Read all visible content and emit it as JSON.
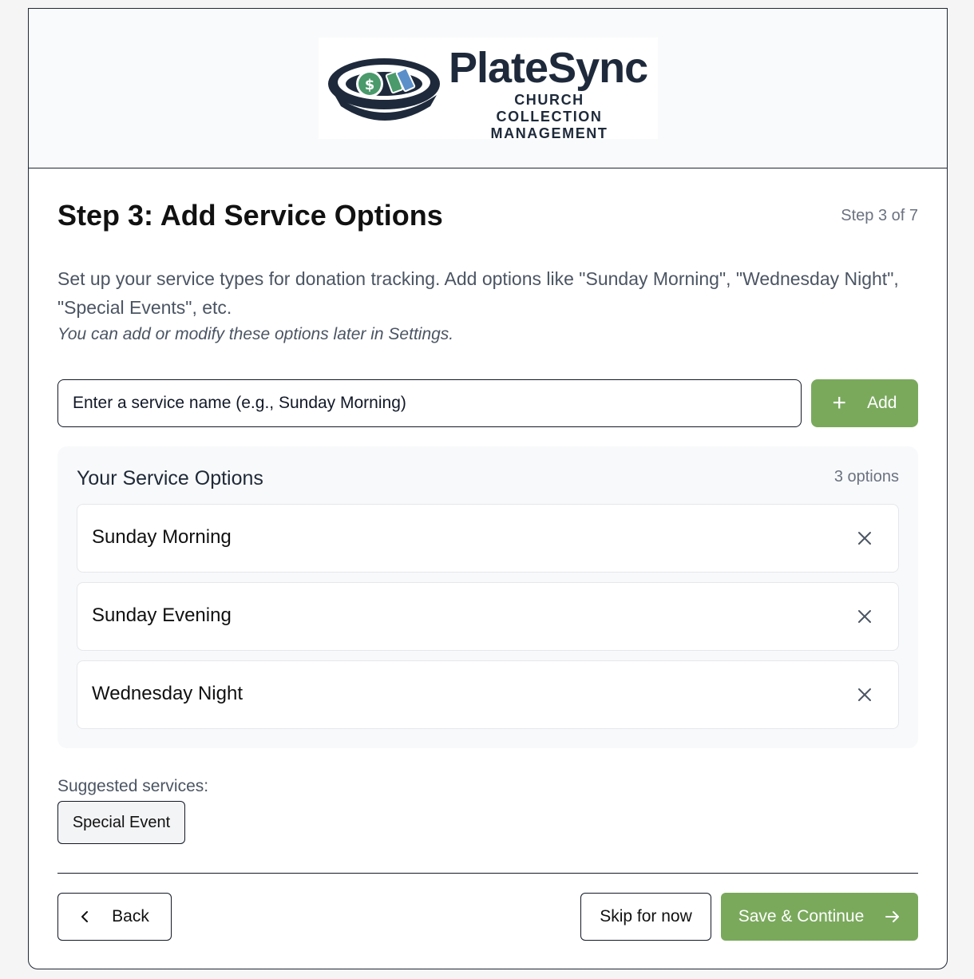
{
  "brand": {
    "name": "PlateSync",
    "tagline_line1": "CHURCH COLLECTION",
    "tagline_line2": "MANAGEMENT",
    "colors": {
      "navy": "#1e2a3b",
      "green": "#7aa95c"
    }
  },
  "step": {
    "title": "Step 3: Add Service Options",
    "counter": "Step 3 of 7",
    "description": "Set up your service types for donation tracking. Add options like \"Sunday Morning\", \"Wednesday Night\", \"Special Events\", etc.",
    "hint": "You can add or modify these options later in Settings."
  },
  "input": {
    "placeholder": "Enter a service name (e.g., Sunday Morning)",
    "add_label": "Add",
    "add_icon": "plus-icon"
  },
  "options": {
    "title": "Your Service Options",
    "count_label": "3 options",
    "items": [
      {
        "label": "Sunday Morning",
        "remove_icon": "close-icon"
      },
      {
        "label": "Sunday Evening",
        "remove_icon": "close-icon"
      },
      {
        "label": "Wednesday Night",
        "remove_icon": "close-icon"
      }
    ]
  },
  "suggestions": {
    "label": "Suggested services:",
    "items": [
      "Special Event"
    ]
  },
  "footer": {
    "back_label": "Back",
    "back_icon": "chevron-left-icon",
    "skip_label": "Skip for now",
    "save_label": "Save & Continue",
    "save_icon": "arrow-right-icon"
  }
}
